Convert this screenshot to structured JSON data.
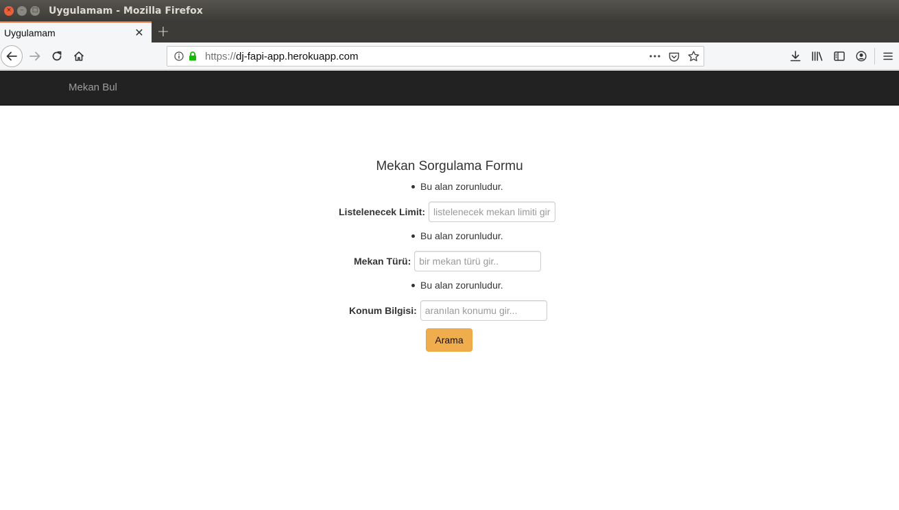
{
  "window": {
    "title": "Uygulamam - Mozilla Firefox",
    "close_glyph": "×",
    "minimize_glyph": "–",
    "maximize_glyph": "□"
  },
  "tabs": [
    {
      "label": "Uygulamam",
      "active": true,
      "close_glyph": "✕"
    }
  ],
  "new_tab_glyph": "+",
  "urlbar": {
    "scheme": "https://",
    "host": "dj-fapi-app.herokuapp.com",
    "secure_color": "#12bc00"
  },
  "site": {
    "brand": "Mekan Bul",
    "nav_background": "#222222"
  },
  "form": {
    "title": "Mekan Sorgulama Formu",
    "fields": [
      {
        "error": "Bu alan zorunludur.",
        "label": "Listelenecek Limit:",
        "placeholder": "listelenecek mekan limiti gir...",
        "value": ""
      },
      {
        "error": "Bu alan zorunludur.",
        "label": "Mekan Türü:",
        "placeholder": "bir mekan türü gir..",
        "value": ""
      },
      {
        "error": "Bu alan zorunludur.",
        "label": "Konum Bilgisi:",
        "placeholder": "aranılan konumu gir...",
        "value": ""
      }
    ],
    "submit_label": "Arama",
    "submit_color": "#f0ad4e"
  },
  "icons": {
    "back": "back-arrow-icon",
    "forward": "forward-arrow-icon",
    "reload": "reload-icon",
    "home": "home-icon",
    "info": "info-icon",
    "lock": "lock-icon",
    "more": "more-dots-icon",
    "pocket": "pocket-icon",
    "bookmark": "star-icon",
    "downloads": "download-icon",
    "library": "library-icon",
    "sidebar": "sidebar-icon",
    "account": "account-icon",
    "menu": "hamburger-menu-icon"
  }
}
